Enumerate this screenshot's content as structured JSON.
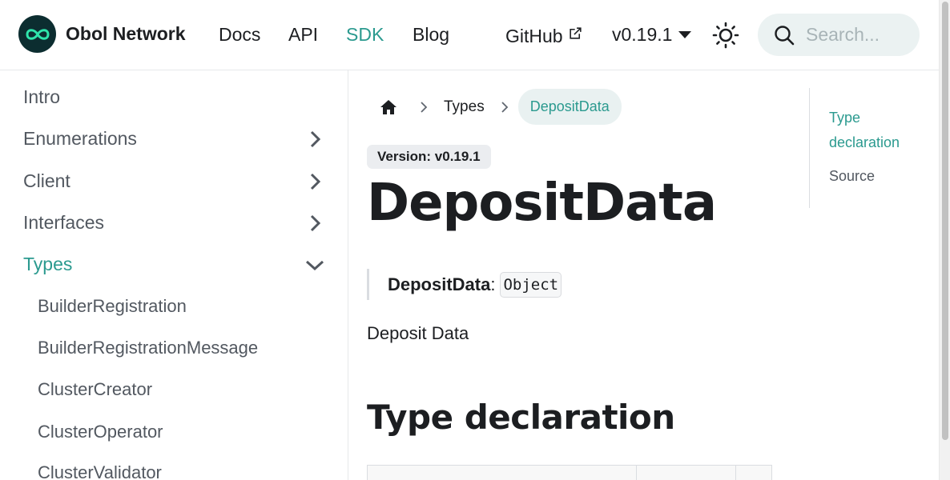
{
  "navbar": {
    "brand": "Obol Network",
    "links": {
      "docs": "Docs",
      "api": "API",
      "sdk": "SDK",
      "blog": "Blog",
      "github": "GitHub"
    },
    "version": "v0.19.1",
    "search_placeholder": "Search..."
  },
  "sidebar": {
    "intro": "Intro",
    "enumerations": "Enumerations",
    "client": "Client",
    "interfaces": "Interfaces",
    "types": "Types",
    "type_items": [
      "BuilderRegistration",
      "BuilderRegistrationMessage",
      "ClusterCreator",
      "ClusterOperator",
      "ClusterValidator"
    ]
  },
  "breadcrumb": {
    "parent": "Types",
    "current": "DepositData"
  },
  "main": {
    "version_badge": "Version: v0.19.1",
    "title": "DepositData",
    "signature_name": "DepositData",
    "signature_colon": ":",
    "signature_type": "Object",
    "description": "Deposit Data",
    "section_heading": "Type declaration"
  },
  "toc": {
    "type_declaration": "Type declaration",
    "source": "Source"
  },
  "colors": {
    "accent": "#2b9a8f",
    "logo_bg": "#0c2d30",
    "search_bg": "#ebf2f2"
  }
}
